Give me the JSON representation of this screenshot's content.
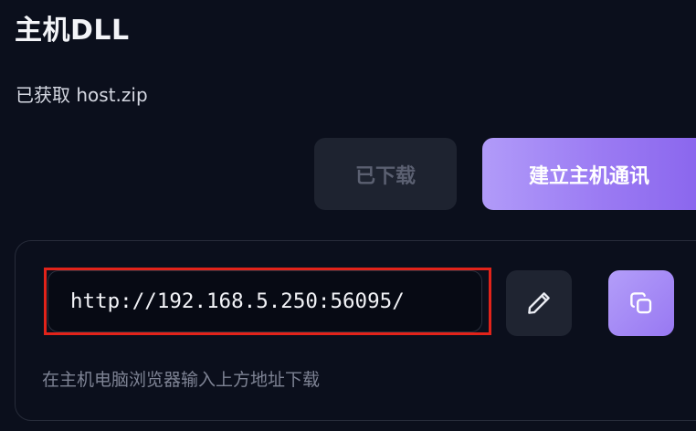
{
  "header": {
    "title": "主机DLL",
    "subtitle": "已获取 host.zip"
  },
  "actions": {
    "downloaded_label": "已下载",
    "connect_label": "建立主机通讯"
  },
  "address_card": {
    "url": "http://192.168.5.250:56095/",
    "hint": "在主机电脑浏览器输入上方地址下载",
    "edit_icon": "pencil-icon",
    "copy_icon": "copy-icon"
  },
  "colors": {
    "background": "#0b0f1c",
    "accent": "#9b7bf3",
    "highlight": "#e2231a"
  }
}
